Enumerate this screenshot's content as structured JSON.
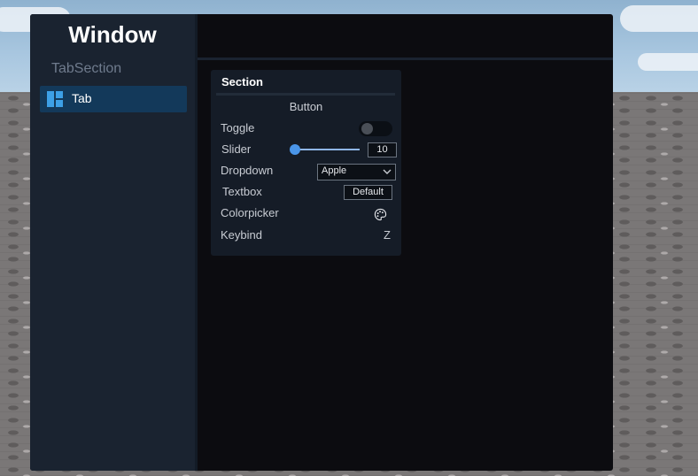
{
  "window": {
    "title": "Window",
    "tab_section": "TabSection",
    "tabs": [
      {
        "label": "Tab",
        "icon": "tab-grid-icon",
        "active": true
      }
    ]
  },
  "section": {
    "title": "Section",
    "button_label": "Button",
    "toggle": {
      "label": "Toggle",
      "value": false
    },
    "slider": {
      "label": "Slider",
      "value": "10"
    },
    "dropdown": {
      "label": "Dropdown",
      "selected": "Apple"
    },
    "textbox": {
      "label": "Textbox",
      "value": "Default"
    },
    "colorpicker": {
      "label": "Colorpicker",
      "icon": "palette-icon"
    },
    "keybind": {
      "label": "Keybind",
      "key": "Z"
    }
  },
  "colors": {
    "window_bg": "#0c0c10",
    "sidebar_bg": "#1a2330",
    "tab_active_bg": "#13395a",
    "accent": "#3d8fe0"
  }
}
